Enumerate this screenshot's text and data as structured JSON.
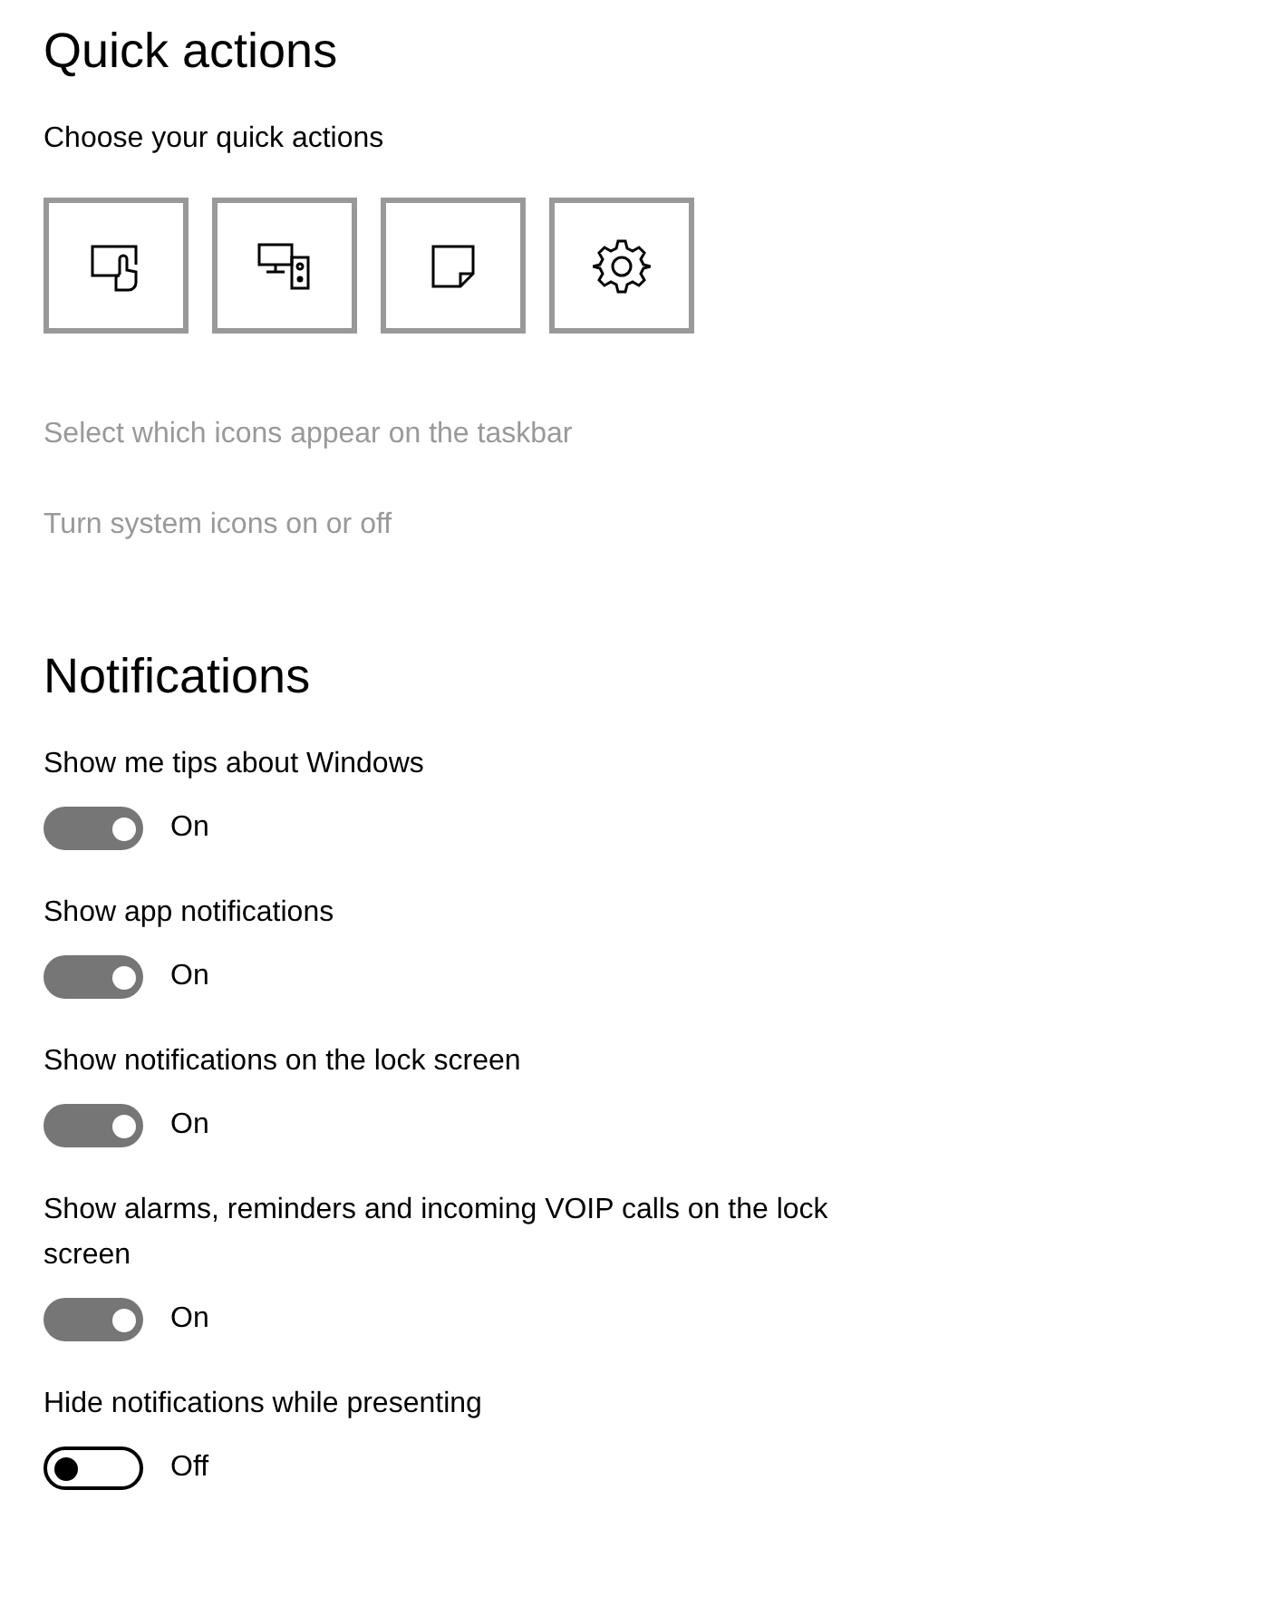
{
  "quick_actions": {
    "title": "Quick actions",
    "subtitle": "Choose your quick actions",
    "tiles": [
      {
        "kind": "tablet"
      },
      {
        "kind": "project"
      },
      {
        "kind": "note"
      },
      {
        "kind": "settings"
      }
    ],
    "links": [
      "Select which icons appear on the taskbar",
      "Turn system icons on or off"
    ]
  },
  "notifications": {
    "title": "Notifications",
    "settings": [
      {
        "label": "Show me tips about Windows",
        "on": true,
        "state": "On"
      },
      {
        "label": "Show app notifications",
        "on": true,
        "state": "On"
      },
      {
        "label": "Show notifications on the lock screen",
        "on": true,
        "state": "On"
      },
      {
        "label": "Show alarms, reminders and incoming VOIP calls on the lock screen",
        "on": true,
        "state": "On"
      },
      {
        "label": "Hide notifications while presenting",
        "on": false,
        "state": "Off"
      }
    ]
  }
}
